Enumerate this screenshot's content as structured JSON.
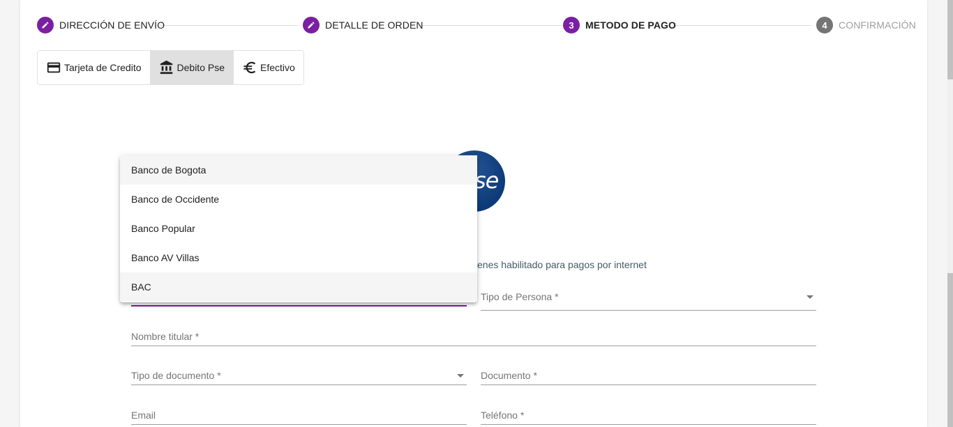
{
  "stepper": {
    "steps": [
      {
        "label": "DIRECCIÓN DE ENVÍO",
        "badge": "",
        "state": "done"
      },
      {
        "label": "DETALLE DE ORDEN",
        "badge": "",
        "state": "done"
      },
      {
        "label": "METODO DE PAGO",
        "badge": "3",
        "state": "current"
      },
      {
        "label": "CONFIRMACIÓN",
        "badge": "4",
        "state": "pending"
      }
    ]
  },
  "payment_methods": [
    {
      "label": "Tarjeta de Credito",
      "icon": "credit-card-icon",
      "selected": false
    },
    {
      "label": "Debito Pse",
      "icon": "bank-icon",
      "selected": true
    },
    {
      "label": "Efectivo",
      "icon": "euro-icon",
      "selected": false
    }
  ],
  "pse_logo": {
    "text": "se"
  },
  "info_text": "tienes habilitado para pagos por internet",
  "bank_dropdown": {
    "options": [
      "Banco de Bogota",
      "Banco de Occidente",
      "Banco Popular",
      "Banco AV Villas",
      "BAC"
    ],
    "highlighted": [
      0,
      4
    ]
  },
  "form": {
    "tipo_persona": "Tipo de Persona *",
    "nombre_titular": "Nombre titular *",
    "tipo_documento": "Tipo de documento *",
    "documento": "Documento *",
    "email": "Email",
    "telefono": "Teléfono *"
  },
  "colors": {
    "accent": "#7b1fa2",
    "inactive": "#757575",
    "pse_blue": "#0d3a78"
  }
}
